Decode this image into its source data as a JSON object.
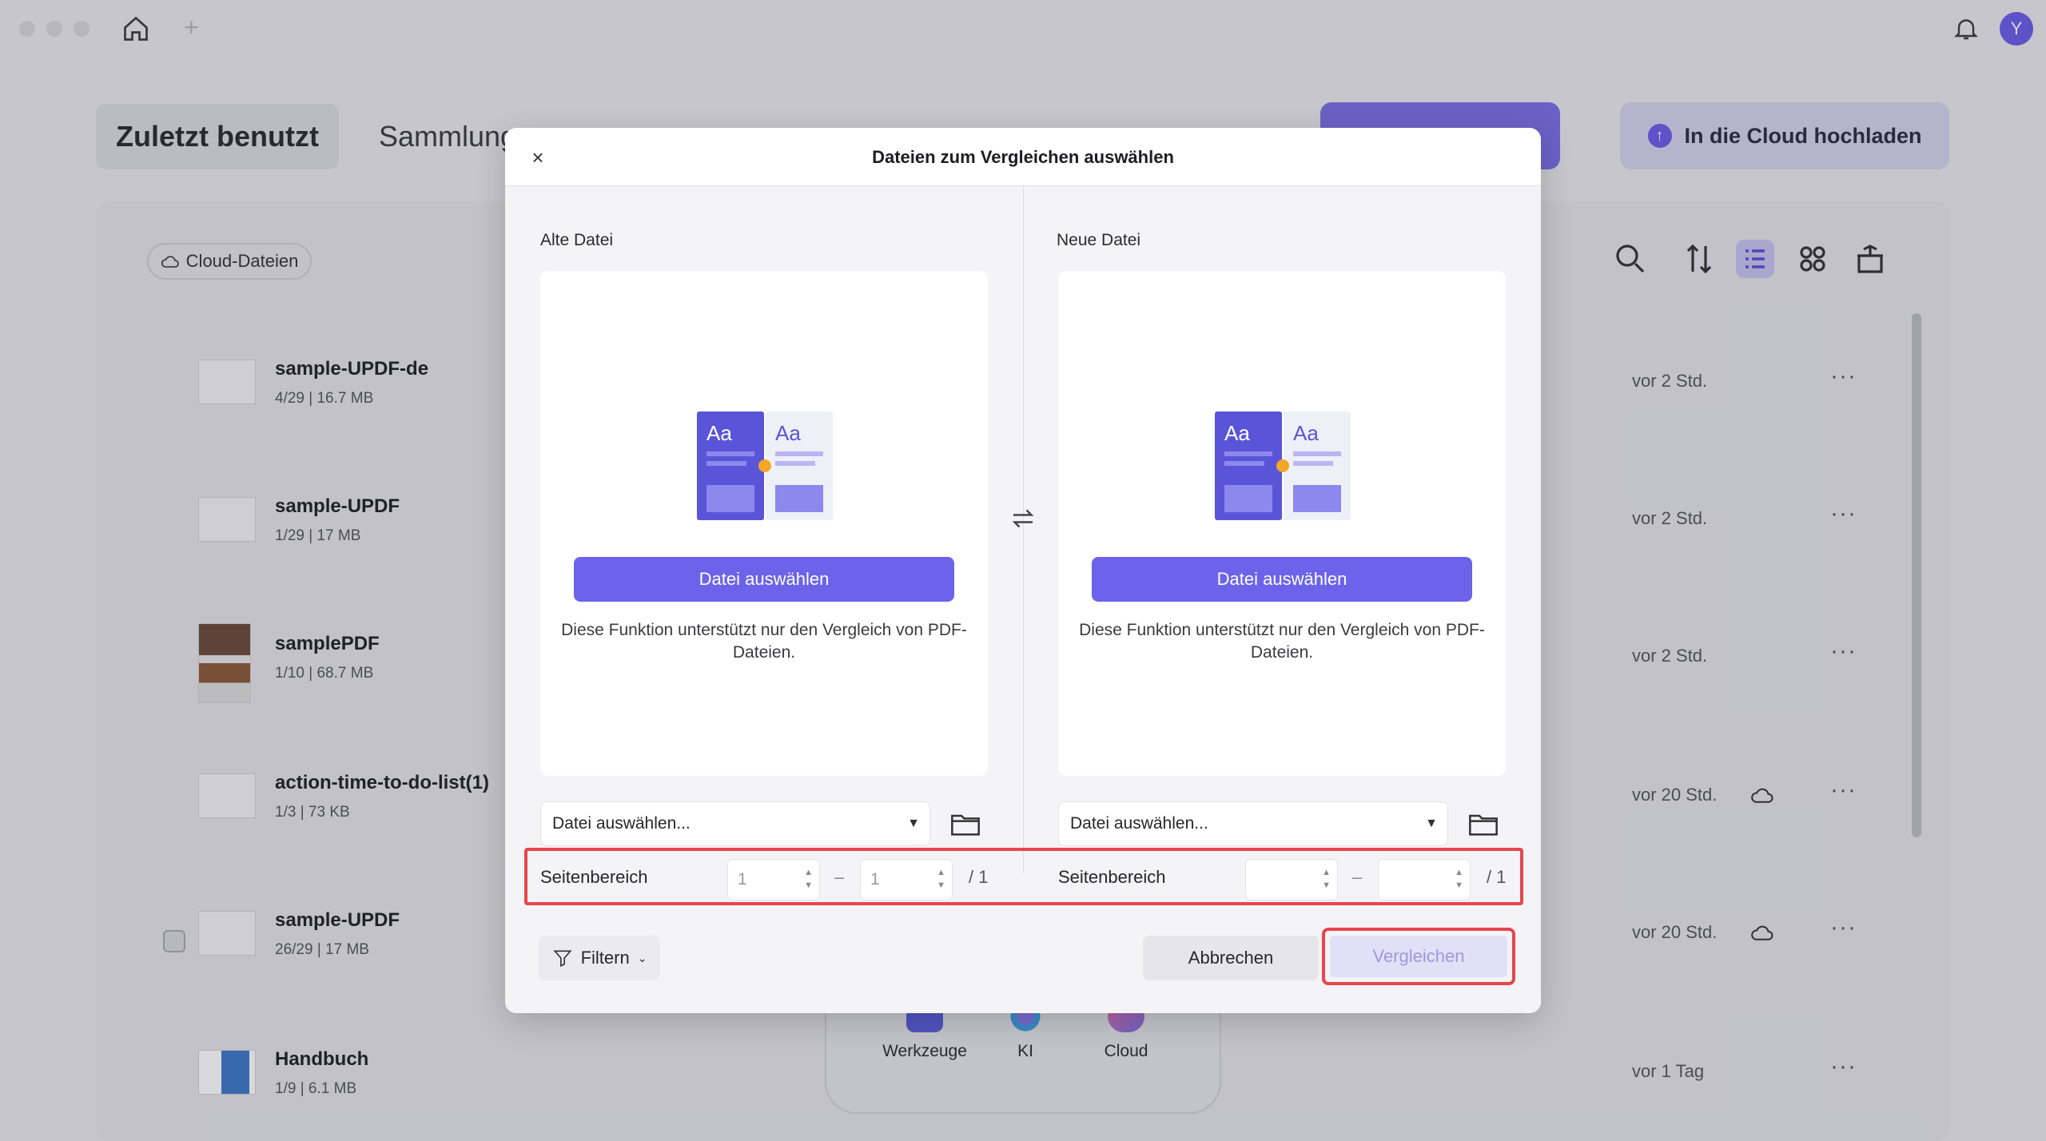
{
  "app": {
    "tabs": {
      "recent": "Zuletzt benutzt",
      "collections": "Sammlung"
    },
    "cloud_upload_label": "In die Cloud hochladen",
    "cloud_files_chip": "Cloud-Dateien",
    "avatar_letter": "Y",
    "files": [
      {
        "name": "sample-UPDF-de",
        "pages": "4/29",
        "size": "16.7 MB",
        "time": "vor 2 Std."
      },
      {
        "name": "sample-UPDF",
        "pages": "1/29",
        "size": "17 MB",
        "time": "vor 2 Std."
      },
      {
        "name": "samplePDF",
        "pages": "1/10",
        "size": "68.7 MB",
        "time": "vor 2 Std."
      },
      {
        "name": "action-time-to-do-list(1)",
        "pages": "1/3",
        "size": "73 KB",
        "time": "vor 20 Std."
      },
      {
        "name": "sample-UPDF",
        "pages": "26/29",
        "size": "17 MB",
        "time": "vor 20 Std."
      },
      {
        "name": "Handbuch",
        "pages": "1/9",
        "size": "6.1 MB",
        "time": "vor 1 Tag"
      }
    ],
    "dock": {
      "tools": "Werkzeuge",
      "ai": "KI",
      "cloud": "Cloud"
    }
  },
  "dialog": {
    "title": "Dateien zum Vergleichen auswählen",
    "old_label": "Alte Datei",
    "new_label": "Neue Datei",
    "choose_button": "Datei auswählen",
    "hint": "Diese Funktion unterstützt nur den Vergleich von PDF-Dateien.",
    "select_placeholder": "Datei auswählen...",
    "range_label": "Seitenbereich",
    "old_range": {
      "from": "1",
      "to": "1",
      "total": "/ 1"
    },
    "new_range": {
      "from": "",
      "to": "",
      "total": "/ 1"
    },
    "filter_label": "Filtern",
    "cancel_label": "Abbrechen",
    "compare_label": "Vergleichen"
  },
  "colors": {
    "accent": "#6c63ea",
    "highlight": "#e8454e"
  }
}
